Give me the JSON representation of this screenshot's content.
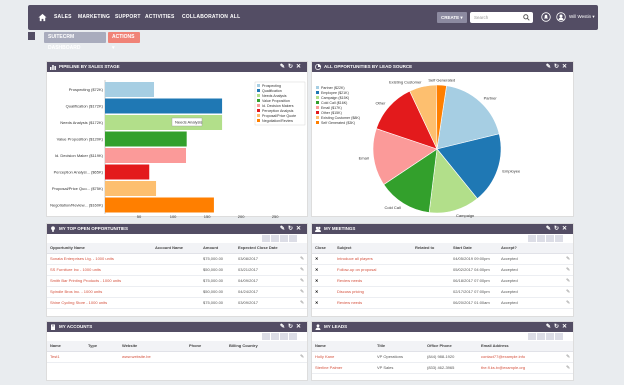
{
  "nav": {
    "items": [
      "SALES",
      "MARKETING",
      "SUPPORT",
      "ACTIVITIES",
      "COLLABORATION",
      "ALL"
    ],
    "create_label": "CREATE ▾",
    "search_placeholder": "Search",
    "user_name": "Will Westin ▾"
  },
  "tabs": {
    "dashboard": "SUITECRM DASHBOARD",
    "actions": "ACTIONS ▾"
  },
  "colors": {
    "nav_bg": "#534d64",
    "accent": "#d4503c",
    "dashboard_tab": "#a9acbd",
    "actions_tab": "#f08377"
  },
  "pipeline": {
    "title": "PIPELINE BY SALES STAGE",
    "tooltip": "Needs Analysis"
  },
  "lead_source": {
    "title": "ALL OPPORTUNITIES BY LEAD SOURCE"
  },
  "chart_data": [
    {
      "type": "bar",
      "orientation": "horizontal",
      "categories": [
        "Prospecting ($72K)",
        "Qualification ($172K)",
        "Needs Analysis ($172K)",
        "Value Proposition ($120K)",
        "Id. Decision Maker ($119K)",
        "Perception Analysi... ($65K)",
        "Proposal/Price Quo... ($75K)",
        "Negotiation/Review... ($160K)"
      ],
      "values": [
        72,
        172,
        172,
        120,
        119,
        65,
        75,
        160
      ],
      "colors": [
        "#a6cee3",
        "#1f78b4",
        "#b2df8a",
        "#33a02c",
        "#fb9a99",
        "#e31a1c",
        "#fdbf6f",
        "#ff7f00"
      ],
      "xticks": [
        "50",
        "100",
        "150",
        "200",
        "250"
      ],
      "xlim": [
        0,
        285
      ],
      "legend": [
        "Prospecting",
        "Qualification",
        "Needs Analysis",
        "Value Proposition",
        "Id. Decision Makers",
        "Perception Analysis",
        "Proposal/Price Quote",
        "Negotiation/Review"
      ],
      "legend_position": "top-right"
    },
    {
      "type": "pie",
      "labels": [
        "Partner",
        "Employee",
        "Campaign",
        "Cold Call",
        "Email",
        "Other",
        "Existing Customer",
        "Self Generated"
      ],
      "values": [
        22,
        21,
        15,
        16,
        17,
        15,
        8,
        3
      ],
      "colors": [
        "#a6cee3",
        "#1f78b4",
        "#b2df8a",
        "#33a02c",
        "#fb9a99",
        "#e31a1c",
        "#fdbf6f",
        "#ff7f00"
      ],
      "legend": [
        "Partner ($22K)",
        "Employee ($21K)",
        "Campaign ($15K)",
        "Cold Call ($16K)",
        "Email ($17K)",
        "Other ($15K)",
        "Existing Customer ($8K)",
        "Self Generated ($3K)"
      ],
      "legend_position": "top-left"
    }
  ],
  "opportunities": {
    "title": "MY TOP OPEN OPPORTUNITIES",
    "columns": [
      "Opportunity Name",
      "Account Name",
      "Amount",
      "Expected Close Date"
    ],
    "rows": [
      [
        "Sonata Enterprises Ltg. - 1000 units",
        "",
        "$75,000.00",
        "03/08/2017"
      ],
      [
        "SS Furniture Inc - 1000 units",
        "",
        "$50,000.00",
        "03/21/2017"
      ],
      [
        "Smith Bar Printing Products - 1000 units",
        "",
        "$75,000.00",
        "04/09/2017"
      ],
      [
        "Spindle Bros Inc. - 1000 units",
        "",
        "$50,000.00",
        "04/24/2017"
      ],
      [
        "Shine Cycling Store - 1000 units",
        "",
        "$75,000.00",
        "03/09/2017"
      ]
    ]
  },
  "meetings": {
    "title": "MY MEETINGS",
    "columns": [
      "Close",
      "Subject",
      "Related to",
      "Start Date",
      "Accept?"
    ],
    "rows": [
      [
        "Introduce all players",
        "",
        "04/05/2019 09:00pm",
        "Accepted"
      ],
      [
        "Follow-up on proposal",
        "",
        "05/02/2017 04:00pm",
        "Accepted"
      ],
      [
        "Review needs",
        "",
        "06/18/2017 07:00pm",
        "Accepted"
      ],
      [
        "Discuss pricing",
        "",
        "02/17/2017 07:00pm",
        "Accepted"
      ],
      [
        "Review needs",
        "",
        "06/20/2017 01:00am",
        "Accepted"
      ]
    ]
  },
  "accounts": {
    "title": "MY ACCOUNTS",
    "columns": [
      "Name",
      "Type",
      "Website",
      "Phone",
      "Billing Country"
    ],
    "rows": [
      [
        "Test1",
        "",
        "www.website.be",
        "",
        ""
      ]
    ]
  },
  "leads": {
    "title": "MY LEADS",
    "columns": [
      "Name",
      "Title",
      "Office Phone",
      "Email Address"
    ],
    "rows": [
      [
        "Holly Kane",
        "VP Operations",
        "(844) 988-1920",
        "contact77@example.info"
      ],
      [
        "Sterline Palmer",
        "VP Sales",
        "(833) 462-3965",
        "the.fl.ks.tv@example.org"
      ]
    ]
  }
}
